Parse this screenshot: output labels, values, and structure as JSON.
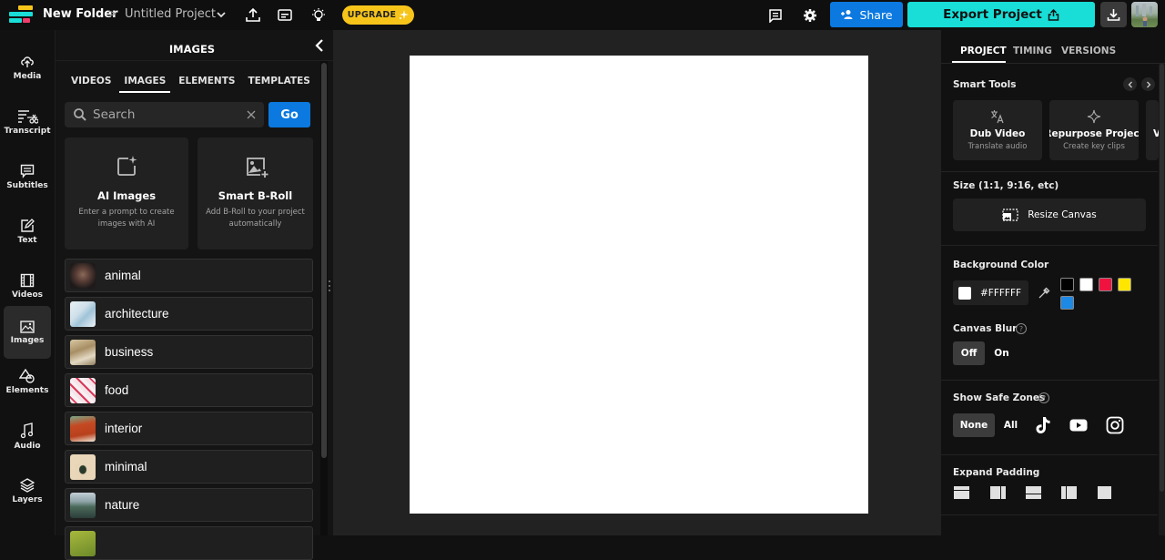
{
  "topbar": {
    "folder": "New Folder",
    "separator": ">",
    "project_title": "Untitled Project",
    "upgrade_label": "UPGRADE",
    "share_label": "Share",
    "export_label": "Export Project",
    "icons": [
      "logo-icon",
      "chevron-down-icon",
      "upload-icon",
      "subtitles-icon",
      "lightbulb-icon",
      "sparkle-icon",
      "comment-icon",
      "gear-icon",
      "add-person-icon",
      "export-icon",
      "download-icon",
      "avatar"
    ]
  },
  "rail": {
    "items": [
      {
        "label": "Media",
        "icon": "cloud-upload-icon"
      },
      {
        "label": "Transcript",
        "icon": "transcript-scissors-icon"
      },
      {
        "label": "Subtitles",
        "icon": "subtitles-bubble-icon"
      },
      {
        "label": "Text",
        "icon": "text-edit-icon"
      },
      {
        "label": "Videos",
        "icon": "film-icon"
      },
      {
        "label": "Images",
        "icon": "image-icon",
        "active": true
      },
      {
        "label": "Elements",
        "icon": "shapes-icon"
      },
      {
        "label": "Audio",
        "icon": "music-note-icon"
      },
      {
        "label": "Layers",
        "icon": "layers-icon"
      }
    ]
  },
  "library": {
    "title": "IMAGES",
    "tabs": [
      {
        "label": "VIDEOS"
      },
      {
        "label": "IMAGES",
        "active": true
      },
      {
        "label": "ELEMENTS"
      },
      {
        "label": "TEMPLATES"
      }
    ],
    "search": {
      "placeholder": "Search",
      "value": "",
      "go_label": "Go"
    },
    "cards": [
      {
        "title": "AI Images",
        "desc": "Enter a prompt to create images with AI",
        "icon": "ai-image-sparkle-icon"
      },
      {
        "title": "Smart B-Roll",
        "desc": "Add B-Roll to your project automatically",
        "icon": "image-add-icon"
      }
    ],
    "categories": [
      {
        "label": "animal"
      },
      {
        "label": "architecture"
      },
      {
        "label": "business"
      },
      {
        "label": "food"
      },
      {
        "label": "interior"
      },
      {
        "label": "minimal"
      },
      {
        "label": "nature"
      }
    ]
  },
  "right_panel": {
    "tabs": [
      {
        "label": "PROJECT",
        "active": true
      },
      {
        "label": "TIMING"
      },
      {
        "label": "VERSIONS"
      }
    ],
    "smart_tools": {
      "title": "Smart Tools",
      "tools": [
        {
          "title": "Dub Video",
          "desc": "Translate audio",
          "icon": "translate-icon"
        },
        {
          "title": "Repurpose Project",
          "desc": "Create key clips",
          "icon": "sparkle-icon"
        },
        {
          "title": "V",
          "desc": "",
          "icon": ""
        }
      ]
    },
    "size": {
      "title": "Size (1:1, 9:16, etc)",
      "button_label": "Resize Canvas"
    },
    "background": {
      "title": "Background Color",
      "value": "#FFFFFF",
      "swatches": [
        "#000000",
        "#FFFFFF",
        "#F0133F",
        "#FFE600",
        "#1E88E5"
      ]
    },
    "canvas_blur": {
      "title": "Canvas Blur",
      "options": [
        "Off",
        "On"
      ],
      "selected": "Off"
    },
    "safe_zones": {
      "title": "Show Safe Zones",
      "options": [
        "None",
        "All"
      ],
      "selected": "None",
      "platform_icons": [
        "tiktok-icon",
        "youtube-icon",
        "instagram-icon"
      ]
    },
    "expand_padding": {
      "title": "Expand Padding",
      "icons": [
        "pad-top-icon",
        "pad-right-icon",
        "pad-vertical-icon",
        "pad-horizontal-icon",
        "pad-all-icon"
      ]
    }
  },
  "canvas": {
    "background": "#FFFFFF"
  }
}
